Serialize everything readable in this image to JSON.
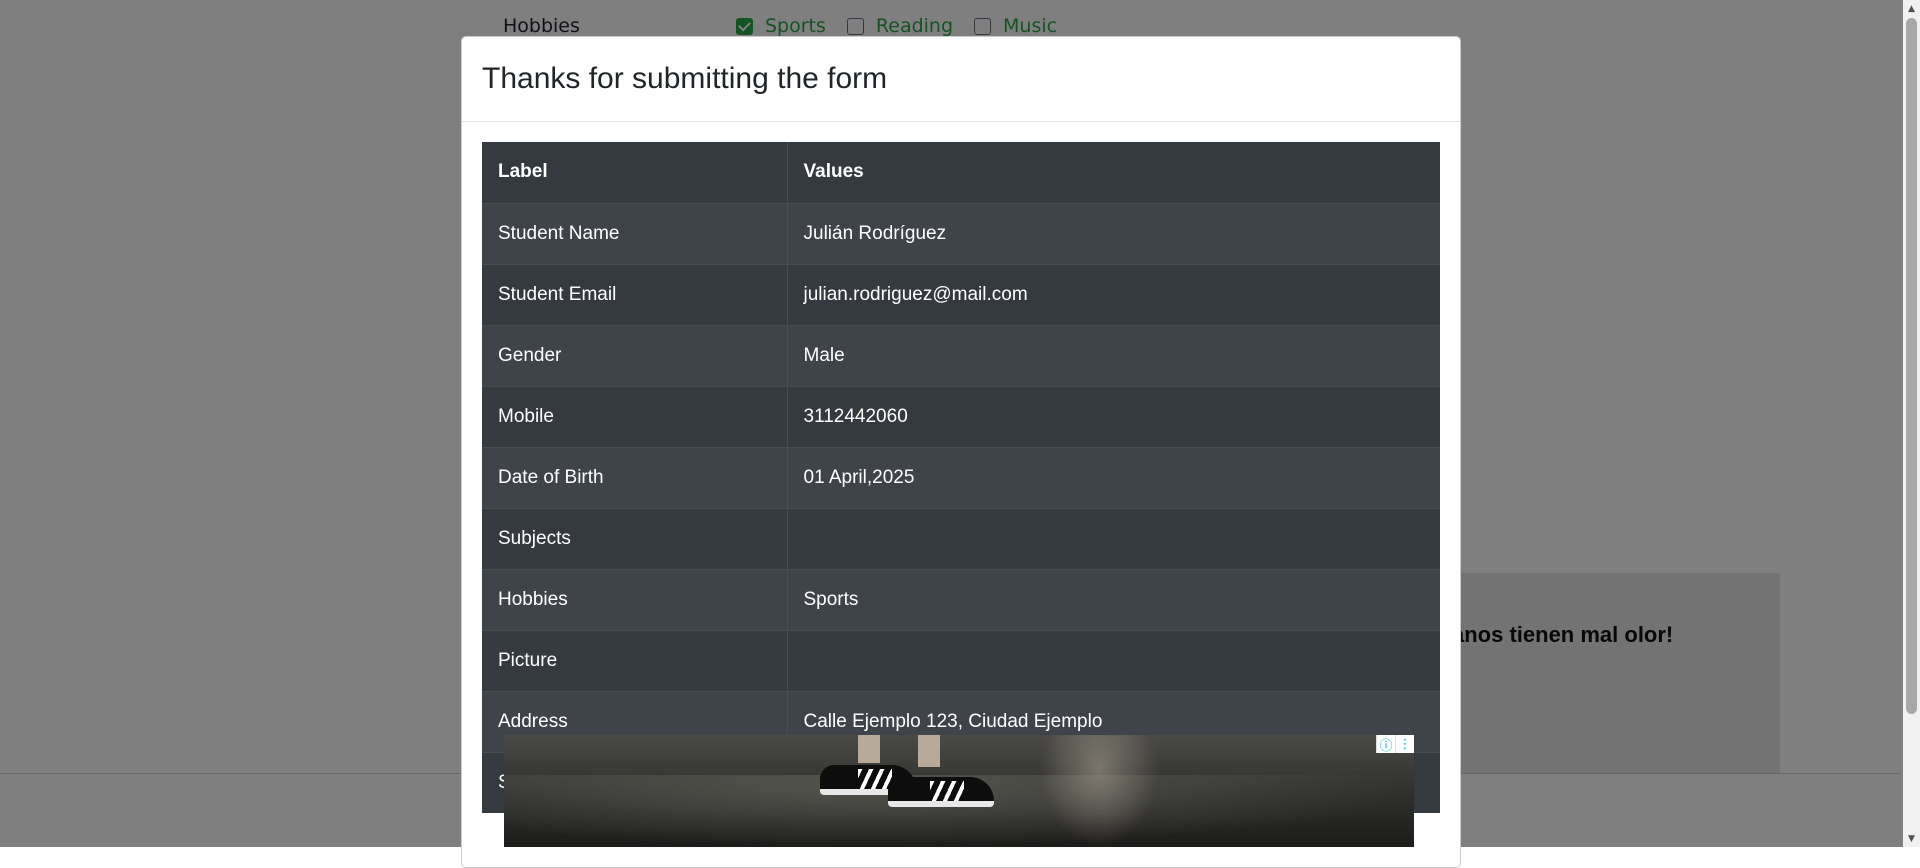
{
  "background": {
    "hobbies_label": "Hobbies",
    "hobbies_options": [
      {
        "label": "Sports",
        "checked": true
      },
      {
        "label": "Reading",
        "checked": false
      },
      {
        "label": "Music",
        "checked": false
      }
    ],
    "ad_text": "anos tienen mal olor!"
  },
  "modal": {
    "title": "Thanks for submitting the form",
    "table": {
      "headers": [
        "Label",
        "Values"
      ],
      "rows": [
        {
          "label": "Student Name",
          "value": "Julián Rodríguez"
        },
        {
          "label": "Student Email",
          "value": "julian.rodriguez@mail.com"
        },
        {
          "label": "Gender",
          "value": "Male"
        },
        {
          "label": "Mobile",
          "value": "3112442060"
        },
        {
          "label": "Date of Birth",
          "value": "01 April,2025"
        },
        {
          "label": "Subjects",
          "value": ""
        },
        {
          "label": "Hobbies",
          "value": "Sports"
        },
        {
          "label": "Picture",
          "value": ""
        },
        {
          "label": "Address",
          "value": "Calle Ejemplo 123, Ciudad Ejemplo"
        },
        {
          "label": "S",
          "value": ""
        }
      ]
    }
  },
  "ad_banner": {
    "controls": [
      "info-icon",
      "more-vert-icon"
    ]
  },
  "colors": {
    "table_bg": "#343a40",
    "accent_green": "#28a745",
    "backdrop": "rgba(0,0,0,0.5)"
  }
}
